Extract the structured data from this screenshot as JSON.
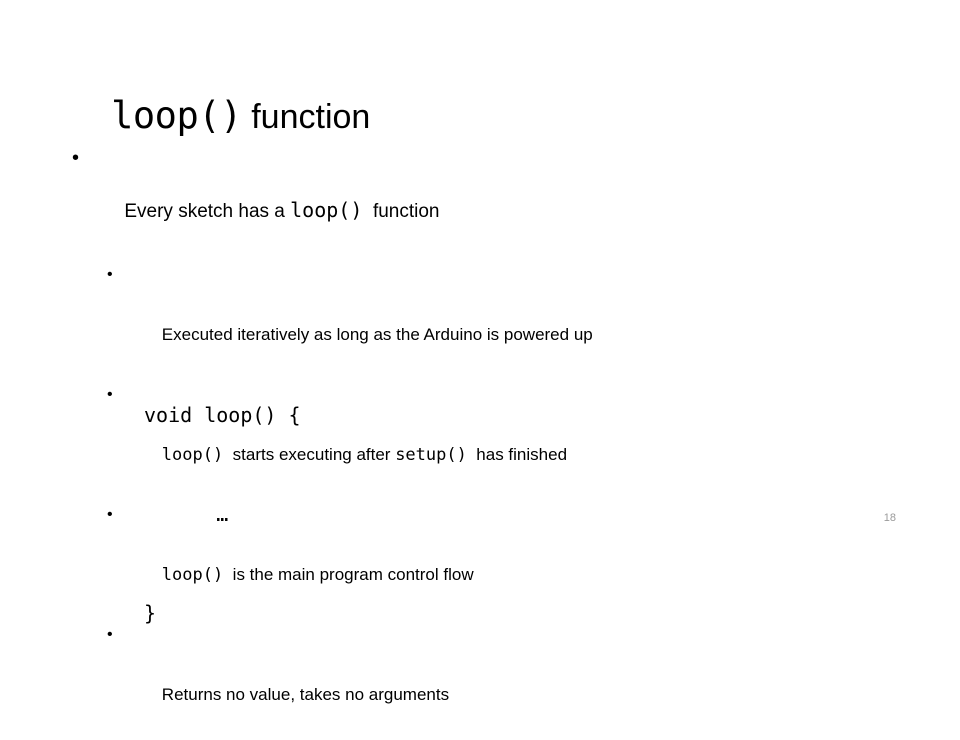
{
  "slide": {
    "title": {
      "code_part": "loop()",
      "text_part": " function"
    },
    "bullets": [
      {
        "marker": "•",
        "segments": [
          {
            "type": "text",
            "value": "Every sketch has a "
          },
          {
            "type": "code",
            "value": "loop()"
          },
          {
            "type": "text",
            "value": "  function"
          }
        ],
        "children": [
          {
            "marker": "•",
            "segments": [
              {
                "type": "text",
                "value": "Executed iteratively as long as the Arduino is powered up"
              }
            ]
          },
          {
            "marker": "•",
            "segments": [
              {
                "type": "code",
                "value": "loop()"
              },
              {
                "type": "text",
                "value": "  starts executing after "
              },
              {
                "type": "code",
                "value": "setup()"
              },
              {
                "type": "text",
                "value": "  has finished"
              }
            ]
          },
          {
            "marker": "•",
            "segments": [
              {
                "type": "code",
                "value": "loop()"
              },
              {
                "type": "text",
                "value": "  is the main program control flow"
              }
            ]
          },
          {
            "marker": "•",
            "segments": [
              {
                "type": "text",
                "value": "Returns no value, takes no arguments"
              }
            ]
          }
        ]
      }
    ],
    "code_block": {
      "lines": [
        "void loop() {",
        "      …",
        "}"
      ]
    },
    "slide_number": "18",
    "colors": {
      "background": "#ffffff",
      "text": "#000000",
      "slide_number": "#9a9a9a"
    }
  }
}
